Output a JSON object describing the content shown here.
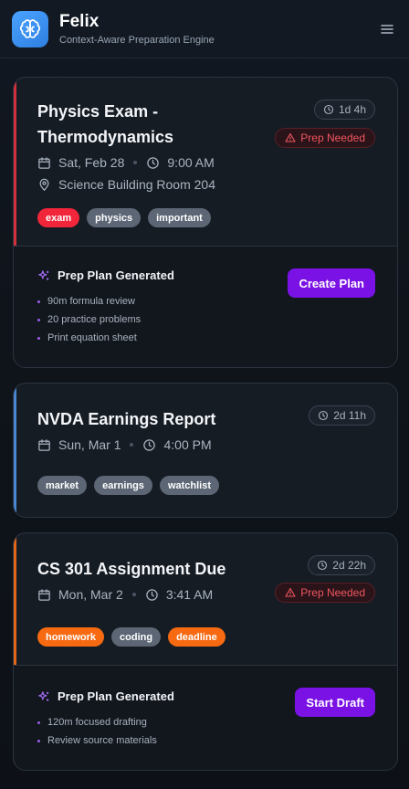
{
  "app": {
    "name": "Felix",
    "tagline": "Context-Aware Preparation Engine"
  },
  "colors": {
    "accent_red": "#d1303c",
    "accent_blue": "#4a86d1",
    "accent_orange": "#e0661a",
    "primary_button": "#7a12e6",
    "logo_blue": "#3b8ff0"
  },
  "events": [
    {
      "title": "Physics Exam - Thermodynamics",
      "date": "Sat, Feb 28",
      "time": "9:00 AM",
      "location": "Science Building Room 204",
      "countdown": "1d 4h",
      "status": "Prep Needed",
      "tags": [
        "exam",
        "physics",
        "important"
      ],
      "plan": {
        "heading": "Prep Plan Generated",
        "items": [
          "90m formula review",
          "20 practice problems",
          "Print equation sheet"
        ],
        "button": "Create Plan"
      }
    },
    {
      "title": "NVDA Earnings Report",
      "date": "Sun, Mar 1",
      "time": "4:00 PM",
      "countdown": "2d 11h",
      "tags": [
        "market",
        "earnings",
        "watchlist"
      ]
    },
    {
      "title": "CS 301 Assignment Due",
      "date": "Mon, Mar 2",
      "time": "3:41 AM",
      "countdown": "2d 22h",
      "status": "Prep Needed",
      "tags": [
        "homework",
        "coding",
        "deadline"
      ],
      "plan": {
        "heading": "Prep Plan Generated",
        "items": [
          "120m focused drafting",
          "Review source materials"
        ],
        "button": "Start Draft"
      }
    }
  ]
}
